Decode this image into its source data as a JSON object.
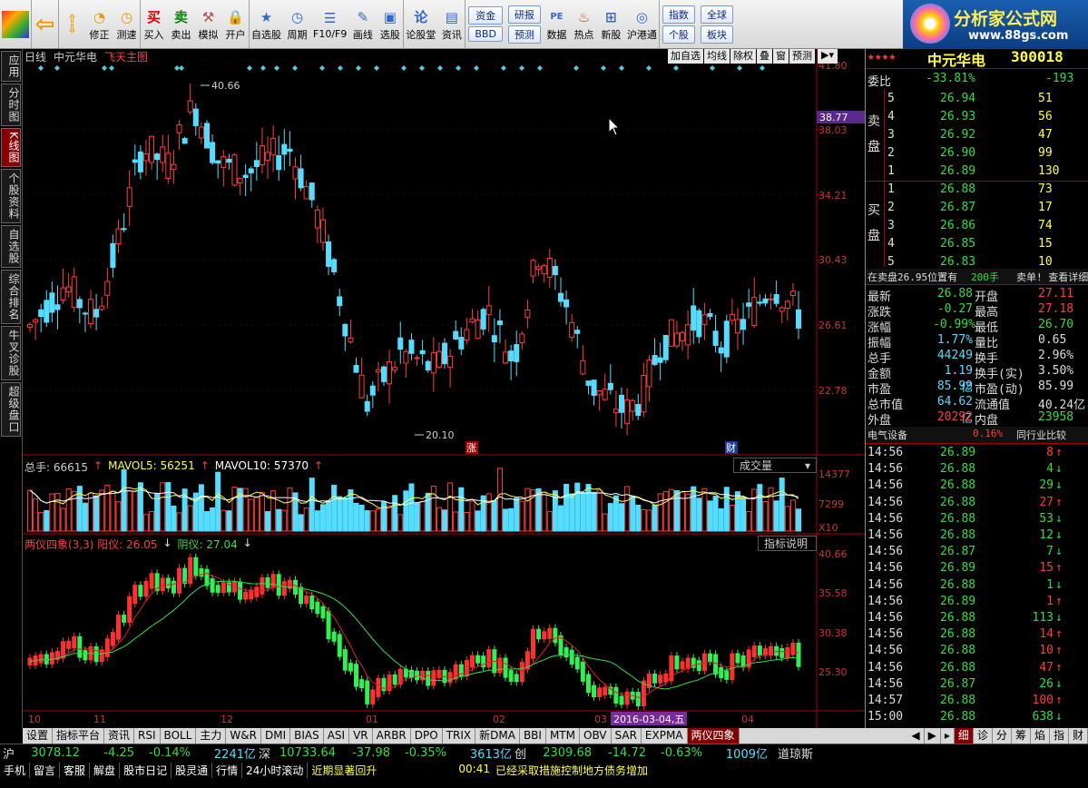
{
  "toolbar": {
    "buttons": [
      "修正",
      "测速",
      "买入",
      "卖出",
      "模拟",
      "开户",
      "自选股",
      "周期",
      "F10/F9",
      "画线",
      "选股",
      "论股堂",
      "资讯",
      "数据",
      "热点",
      "新股",
      "沪港通"
    ],
    "stack1": [
      "资金",
      "BBD"
    ],
    "stack2": [
      "研报",
      "预测"
    ],
    "stack3": [
      "指数",
      "个股"
    ],
    "stack4": [
      "全球",
      "板块"
    ],
    "buy_icon": "买",
    "sell_icon": "卖"
  },
  "logo": {
    "title": "分析家公式网",
    "url_text": "www.88gs.com"
  },
  "left_tabs": [
    "应用",
    "分时图",
    "K线图",
    "个股资料",
    "自选股",
    "综合排名",
    "牛叉诊股",
    "超级盘口"
  ],
  "chart": {
    "period": "日线",
    "stock_name": "中元华电",
    "main_indicator": "飞天主图",
    "buttons": [
      "加自选",
      "均线",
      "除权",
      "叠",
      "窗",
      "预测"
    ],
    "price_axis": [
      "41.80",
      "38.03",
      "34.21",
      "30.43",
      "26.61",
      "22.78"
    ],
    "cur_price_tag": "38.77",
    "high_label": "40.66",
    "low_label": "20.10",
    "marker_up": "涨",
    "marker_cai": "财",
    "x_axis": [
      "10",
      "11",
      "12",
      "01",
      "02",
      "03",
      "04"
    ],
    "date_tag": "2016-03-04,五",
    "vol": {
      "label": "总手: 66615",
      "ma5": "MAVOL5: 56251",
      "ma10": "MAVOL10: 57370",
      "axis": [
        "14377",
        "7299",
        "X10"
      ],
      "selector": "成交量"
    },
    "ind": {
      "label": "两仪四象(3,3) 阳仪: 26.05",
      "yin": "阴仪: 27.04",
      "axis": [
        "40.66",
        "35.58",
        "30.38",
        "25.30"
      ],
      "button": "指标说明"
    }
  },
  "quote": {
    "stars": "★★★★",
    "name": "中元华电",
    "code": "300018",
    "weibi_label": "委比",
    "weibi": "-33.81%",
    "weicha": "-193",
    "sell_label": "卖盘",
    "buy_label": "买盘",
    "asks": [
      {
        "lvl": "5",
        "price": "26.94",
        "vol": "51"
      },
      {
        "lvl": "4",
        "price": "26.93",
        "vol": "56"
      },
      {
        "lvl": "3",
        "price": "26.92",
        "vol": "47"
      },
      {
        "lvl": "2",
        "price": "26.90",
        "vol": "99"
      },
      {
        "lvl": "1",
        "price": "26.89",
        "vol": "130"
      }
    ],
    "bids": [
      {
        "lvl": "1",
        "price": "26.88",
        "vol": "73"
      },
      {
        "lvl": "2",
        "price": "26.87",
        "vol": "17"
      },
      {
        "lvl": "3",
        "price": "26.86",
        "vol": "74"
      },
      {
        "lvl": "4",
        "price": "26.85",
        "vol": "15"
      },
      {
        "lvl": "5",
        "price": "26.83",
        "vol": "10"
      }
    ],
    "note": "在卖盘26.95位置有",
    "note_vol": "200手",
    "note_tail": "卖单! 查看详细",
    "stats": [
      {
        "k": "最新",
        "v": "26.88",
        "k2": "开盘",
        "v2": "27.11"
      },
      {
        "k": "涨跌",
        "v": "-0.27",
        "k2": "最高",
        "v2": "27.18"
      },
      {
        "k": "涨幅",
        "v": "-0.99%",
        "k2": "最低",
        "v2": "26.70"
      },
      {
        "k": "振幅",
        "v": "1.77%",
        "k2": "量比",
        "v2": "0.65"
      },
      {
        "k": "总手",
        "v": "44249",
        "k2": "换手",
        "v2": "2.96%"
      },
      {
        "k": "金额",
        "v": "1.19亿",
        "k2": "换手(实)",
        "v2": "3.50%"
      },
      {
        "k": "市盈",
        "v": "85.99",
        "k2": "市盈(动)",
        "v2": "85.99"
      },
      {
        "k": "总市值",
        "v": "64.62亿",
        "k2": "流通值",
        "v2": "40.24亿"
      },
      {
        "k": "外盘",
        "v": "20292",
        "k2": "内盘",
        "v2": "23958"
      }
    ],
    "sector": "电气设备",
    "sector_pct": "0.16%",
    "compare": "同行业比较",
    "ticks": [
      {
        "t": "14:56",
        "p": "26.89",
        "v": "8",
        "d": "up"
      },
      {
        "t": "14:56",
        "p": "26.88",
        "v": "4",
        "d": "down"
      },
      {
        "t": "14:56",
        "p": "26.88",
        "v": "29",
        "d": "down"
      },
      {
        "t": "14:56",
        "p": "26.88",
        "v": "27",
        "d": "up"
      },
      {
        "t": "14:56",
        "p": "26.88",
        "v": "53",
        "d": "down"
      },
      {
        "t": "14:56",
        "p": "26.88",
        "v": "12",
        "d": "down"
      },
      {
        "t": "14:56",
        "p": "26.87",
        "v": "7",
        "d": "down"
      },
      {
        "t": "14:56",
        "p": "26.89",
        "v": "15",
        "d": "up"
      },
      {
        "t": "14:56",
        "p": "26.88",
        "v": "1",
        "d": "down"
      },
      {
        "t": "14:56",
        "p": "26.89",
        "v": "1",
        "d": "up"
      },
      {
        "t": "14:56",
        "p": "26.88",
        "v": "113",
        "d": "down"
      },
      {
        "t": "14:56",
        "p": "26.88",
        "v": "14",
        "d": "up"
      },
      {
        "t": "14:56",
        "p": "26.88",
        "v": "10",
        "d": "up"
      },
      {
        "t": "14:56",
        "p": "26.88",
        "v": "47",
        "d": "up"
      },
      {
        "t": "14:56",
        "p": "26.87",
        "v": "26",
        "d": "down"
      },
      {
        "t": "14:57",
        "p": "26.88",
        "v": "100",
        "d": "up"
      },
      {
        "t": "15:00",
        "p": "26.88",
        "v": "638",
        "d": "down"
      }
    ],
    "right_tabs": [
      "细",
      "诊",
      "分",
      "筹",
      "焰",
      "指",
      "财"
    ]
  },
  "bottom_tabs": [
    "设置",
    "指标平台",
    "资讯",
    "RSI",
    "BOLL",
    "主力",
    "W&R",
    "DMI",
    "BIAS",
    "ASI",
    "VR",
    "ARBR",
    "DPO",
    "TRIX",
    "新DMA",
    "BBI",
    "MTM",
    "OBV",
    "SAR",
    "EXPMA",
    "两仪四象"
  ],
  "status": {
    "sh_label": "沪",
    "sh": "3078.12",
    "sh_chg": "-4.25",
    "sh_pct": "-0.14%",
    "sh_amt": "2241亿",
    "sz_label": "深",
    "sz": "10733.64",
    "sz_chg": "-37.98",
    "sz_pct": "-0.35%",
    "sz_amt": "3613亿",
    "cy_label": "创",
    "cy": "2309.68",
    "cy_chg": "-14.72",
    "cy_pct": "-0.63%",
    "cy_amt": "1009亿",
    "dj_label": "道琼斯"
  },
  "status2": {
    "items": [
      "手机",
      "留言",
      "客服",
      "解盘",
      "股市日记",
      "股灵通",
      "行情",
      "24小时滚动"
    ],
    "news1": "近期显著回升",
    "news_time": "00:41",
    "news2": "已经采取措施控制地方债务增加"
  },
  "colors": {
    "up": "#ff3c3c",
    "down": "#55ddff",
    "ma_green": "#33dd44",
    "bg": "#000000"
  }
}
